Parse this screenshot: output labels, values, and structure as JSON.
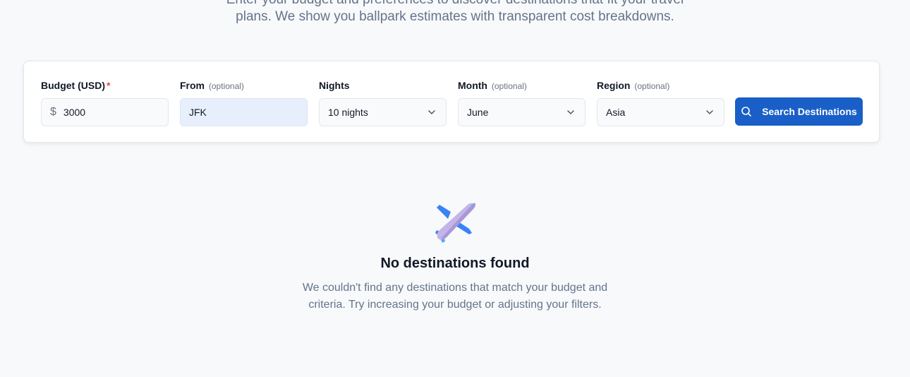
{
  "intro": {
    "line1": "Enter your budget and preferences to discover destinations that fit your travel",
    "line2": "plans. We show you ballpark estimates with transparent cost breakdowns."
  },
  "search_form": {
    "budget": {
      "label": "Budget (USD)",
      "required_marker": "*",
      "prefix": "$",
      "value": "3000"
    },
    "from": {
      "label": "From",
      "optional": "(optional)",
      "value": "JFK"
    },
    "nights": {
      "label": "Nights",
      "value": "10 nights"
    },
    "month": {
      "label": "Month",
      "optional": "(optional)",
      "value": "June"
    },
    "region": {
      "label": "Region",
      "optional": "(optional)",
      "value": "Asia"
    },
    "submit_label": "Search Destinations"
  },
  "empty_state": {
    "icon": "airplane-icon",
    "title": "No destinations found",
    "description": "We couldn't find any destinations that match your budget and criteria. Try increasing your budget or adjusting your filters."
  },
  "colors": {
    "accent": "#1a5fc8",
    "required": "#ef4444",
    "muted_text": "#64748b"
  }
}
